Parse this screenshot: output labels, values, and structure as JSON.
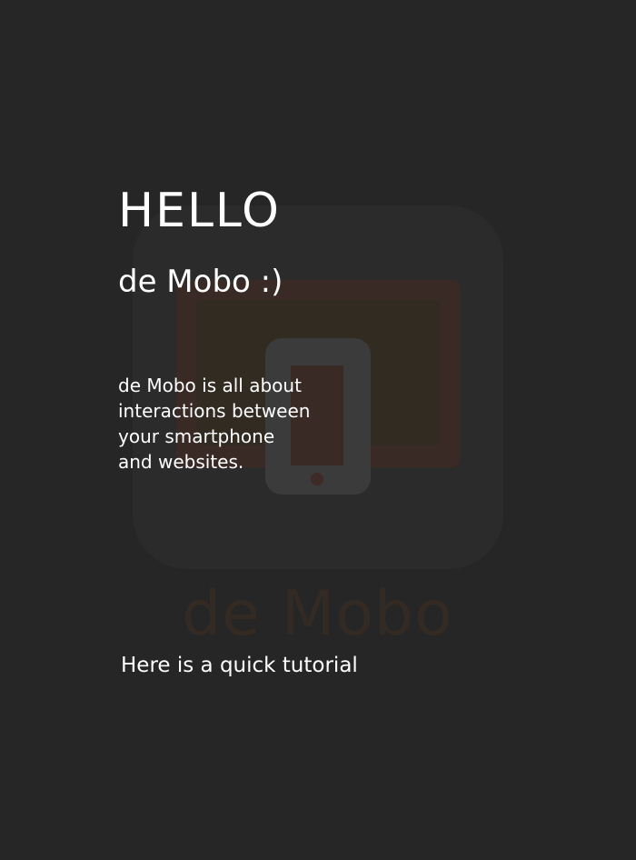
{
  "intro": {
    "title": "HELLO",
    "subtitle": "de Mobo :)",
    "description_lines": [
      "de Mobo is all about",
      "interactions between",
      "your smartphone",
      "and websites."
    ],
    "tutorial_text": "Here is a quick tutorial"
  },
  "watermark": {
    "logo_text": "de Mobo",
    "icon": "phone-and-screen-icon"
  },
  "colors": {
    "background": "#262626",
    "text": "#ffffff",
    "watermark_tile": "#2b2b2b",
    "watermark_accent": "#3a2a25"
  }
}
